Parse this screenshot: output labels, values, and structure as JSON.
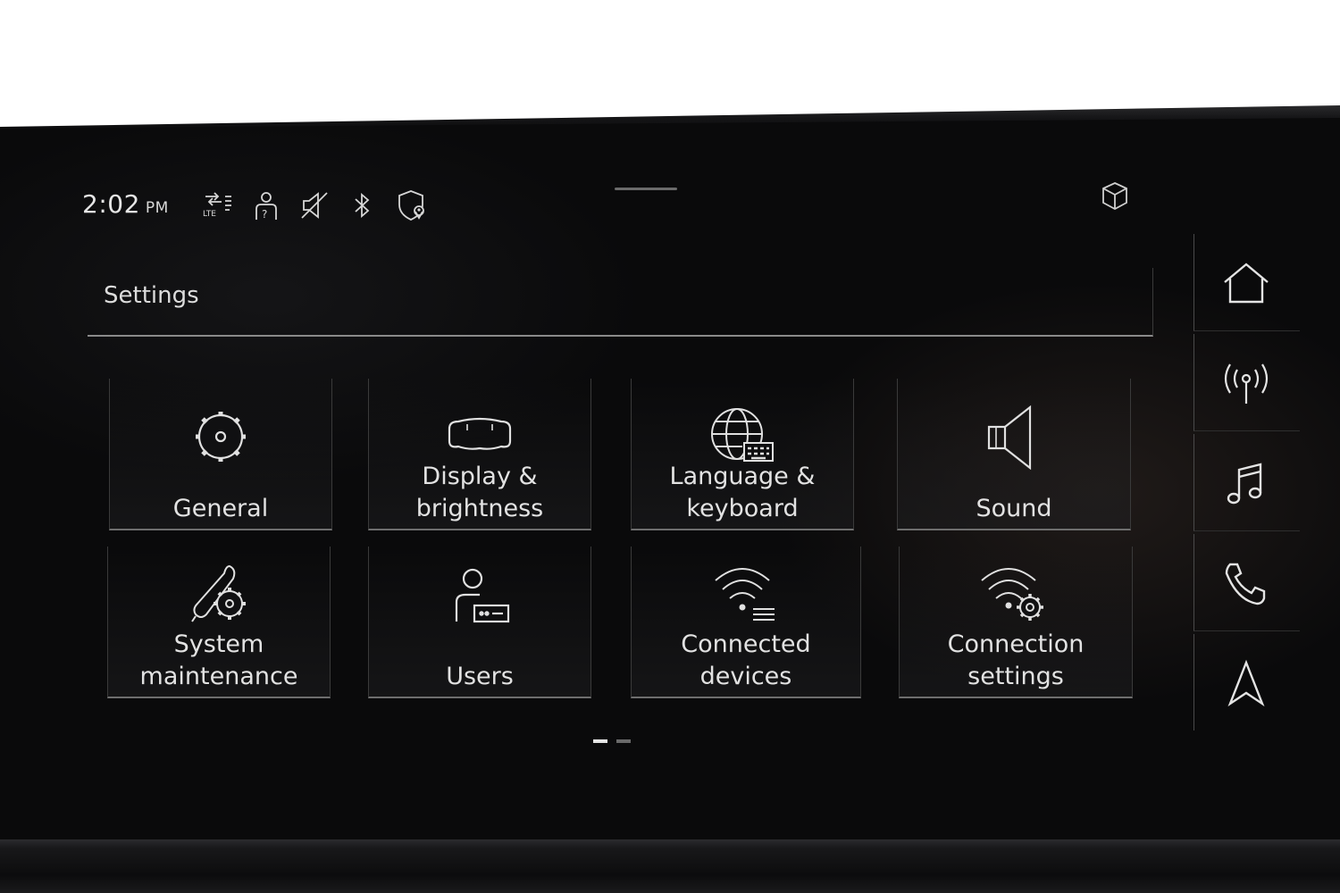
{
  "status_bar": {
    "time": "2:02",
    "ampm": "PM",
    "icons": [
      "lte-icon",
      "user-help-icon",
      "mute-icon",
      "bluetooth-icon",
      "location-shield-icon"
    ],
    "cube_icon": "cube-icon"
  },
  "header": {
    "title": "Settings"
  },
  "tiles": [
    {
      "label": "General",
      "icon": "gear-icon"
    },
    {
      "label": "Display &\nbrightness",
      "icon": "display-icon"
    },
    {
      "label": "Language &\nkeyboard",
      "icon": "globe-keyboard-icon"
    },
    {
      "label": "Sound",
      "icon": "speaker-icon"
    },
    {
      "label": "System\nmaintenance",
      "icon": "wrench-gear-icon"
    },
    {
      "label": "Users",
      "icon": "user-card-icon"
    },
    {
      "label": "Connected\ndevices",
      "icon": "wifi-list-icon"
    },
    {
      "label": "Connection\nsettings",
      "icon": "wifi-gear-icon"
    }
  ],
  "pager": {
    "pages": 2,
    "current": 1
  },
  "nav_rail": [
    {
      "icon": "home-icon"
    },
    {
      "icon": "radio-icon"
    },
    {
      "icon": "music-icon"
    },
    {
      "icon": "phone-icon"
    },
    {
      "icon": "navigation-icon"
    }
  ],
  "colors": {
    "background": "#0a0a0b",
    "text": "#e2e2e2",
    "divider": "#8a8a8a"
  }
}
